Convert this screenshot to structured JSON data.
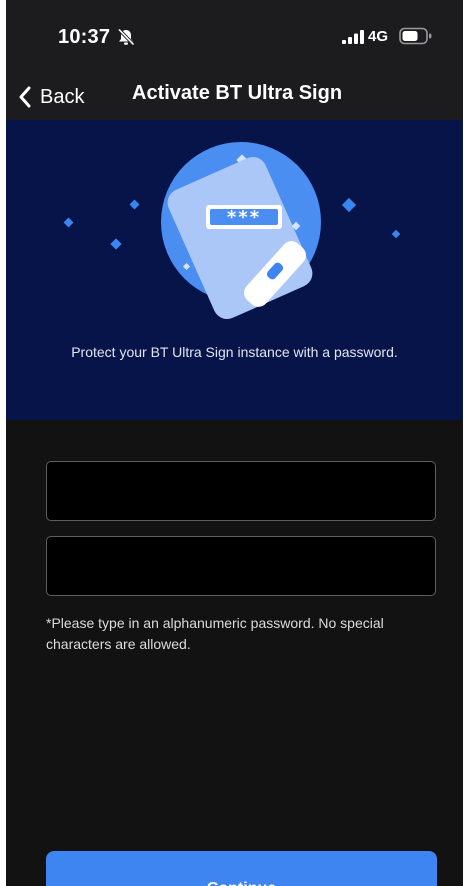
{
  "status_bar": {
    "time": "10:37",
    "network": "4G",
    "icons": [
      "bell-slash-icon",
      "signal-bars-icon",
      "battery-icon"
    ]
  },
  "nav": {
    "back_label": "Back",
    "title": "Activate BT Ultra Sign",
    "icons": [
      "chevron-left-icon"
    ]
  },
  "hero": {
    "message": "Protect your BT Ultra Sign instance with a password.",
    "illustration_icon": "phone-password-icon",
    "password_mask": "***"
  },
  "form": {
    "password_value": "",
    "confirm_value": "",
    "hint": "*Please type in an alphanumeric password. No special characters are allowed.",
    "continue_label": "Continue"
  },
  "colors": {
    "hero_background": "#07144a",
    "accent": "#3f85f2",
    "nav_background": "#1c1c1e",
    "form_background": "#121212"
  }
}
